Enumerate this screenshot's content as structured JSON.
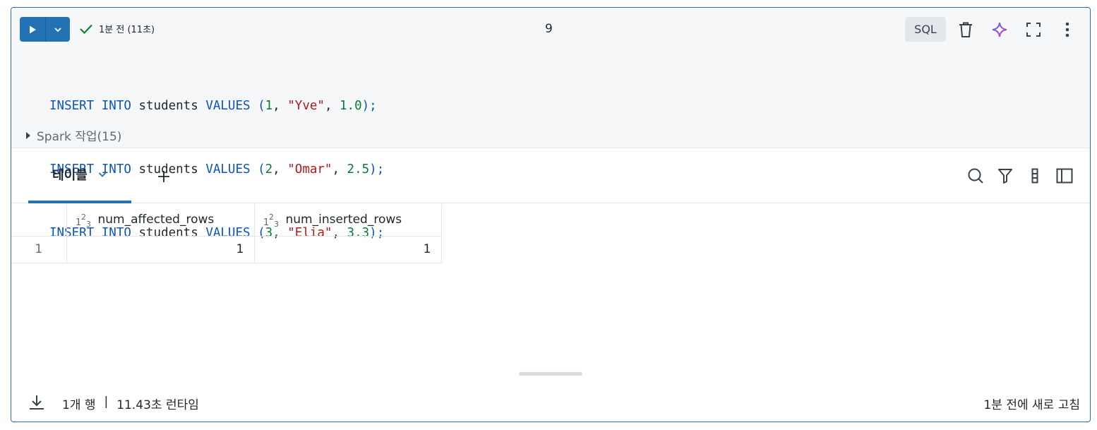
{
  "cell": {
    "status_text": "1분 전 (11초)",
    "cell_number": "9",
    "language": "SQL",
    "icons": {
      "run": "play-icon",
      "run_menu": "chevron-down-icon",
      "status": "check-icon",
      "delete": "trash-icon",
      "assistant": "sparkle-icon",
      "fullscreen": "expand-icon",
      "more": "more-vertical-icon"
    },
    "code_lines": [
      {
        "kw1": "INSERT",
        "kw2": "INTO",
        "table": "students",
        "kw3": "VALUES",
        "open": "(",
        "id": "1",
        "c1": ", ",
        "name": "\"Yve\"",
        "c2": ", ",
        "score": "1.0",
        "close": ");"
      },
      {
        "kw1": "INSERT",
        "kw2": "INTO",
        "table": "students",
        "kw3": "VALUES",
        "open": "(",
        "id": "2",
        "c1": ", ",
        "name": "\"Omar\"",
        "c2": ", ",
        "score": "2.5",
        "close": ");"
      },
      {
        "kw1": "INSERT",
        "kw2": "INTO",
        "table": "students",
        "kw3": "VALUES",
        "open": "(",
        "id": "3",
        "c1": ", ",
        "name": "\"Elia\"",
        "c2": ", ",
        "score": "3.3",
        "close": ");"
      }
    ],
    "spark_jobs": "Spark 작업(15)"
  },
  "results": {
    "tab_label": "테이블",
    "add_tab": "+",
    "columns": [
      "num_affected_rows",
      "num_inserted_rows"
    ],
    "column_type_icon": "numeric-type-icon",
    "rows": [
      {
        "index": "1",
        "values": [
          "1",
          "1"
        ]
      }
    ],
    "footer": {
      "row_count": "1개 행",
      "separator": "|",
      "runtime": "11.43초 런타임",
      "refreshed": "1분 전에 새로 고침"
    }
  },
  "colors": {
    "accent": "#2272b4",
    "keyword": "#0b53c1",
    "number": "#0b7a3b",
    "string": "#b31818",
    "success": "#1a7f37"
  }
}
